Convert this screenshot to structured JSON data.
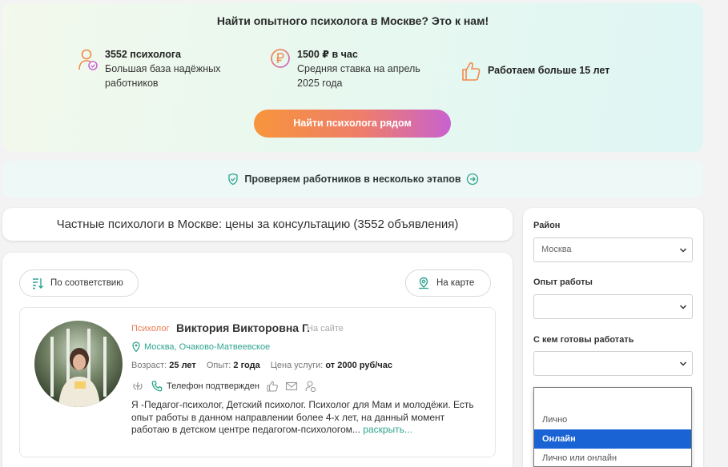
{
  "hero": {
    "title": "Найти опытного психолога в Москве? Это к нам!",
    "features": [
      {
        "icon": "user-check-icon",
        "title": "3552 психолога",
        "desc": [
          "Большая база надёжных",
          "работников"
        ]
      },
      {
        "icon": "ruble-coin-icon",
        "title": "1500 ₽ в час",
        "desc": [
          "Средняя ставка на апрель",
          "2025 года"
        ]
      },
      {
        "icon": "thumbs-up-icon",
        "title": "Работаем больше 15 лет",
        "desc": []
      }
    ],
    "cta_label": "Найти психолога рядом"
  },
  "verify": {
    "text": "Проверяем работников в несколько этапов"
  },
  "listing": {
    "heading": "Частные психологи в Москве: цены за консультацию (3552 объявления)",
    "sort_label": "По соответствию",
    "map_label": "На карте"
  },
  "profile": {
    "role": "Психолог",
    "name": "Виктория Викторовна Г.",
    "status": "На сайте",
    "location": "Москва, Очаково-Матвеевское",
    "age_label": "Возраст:",
    "age_value": "25 лет",
    "exp_label": "Опыт:",
    "exp_value": "2 года",
    "price_label": "Цена услуги:",
    "price_value": "от 2000 руб/час",
    "phone_badge": "Телефон подтвержден",
    "description": "Я -Педагог-психолог, Детский психолог. Психолог для Мам и молодёжи. Есть опыт работы в данном направлении более 4-х лет, на данный момент работаю в детском центре педагогом-психологом...",
    "more_link": " раскрыть..."
  },
  "filters": {
    "district_label": "Район",
    "district_value": "Москва",
    "experience_label": "Опыт работы",
    "experience_value": "",
    "work_mode_label": "С кем готовы работать",
    "work_mode_value": "",
    "dropdown_options": [
      "",
      "Лично",
      "Онлайн",
      "Лично или онлайн"
    ],
    "dropdown_selected": "Онлайн"
  },
  "colors": {
    "accent_green": "#2fa48f",
    "accent_orange": "#ec7a52",
    "select_blue": "#1a63d4"
  }
}
